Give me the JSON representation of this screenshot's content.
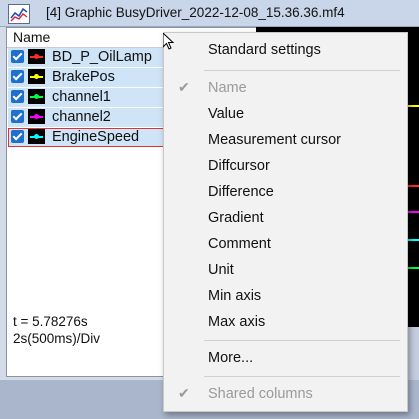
{
  "window": {
    "title": "[4] Graphic BusyDriver_2022-12-08_15.36.36.mf4"
  },
  "signal_list": {
    "column_header": "Name",
    "rows": [
      {
        "label": "BD_P_OilLamp",
        "color": "#ff2a2a",
        "checked": true,
        "selected": false
      },
      {
        "label": "BrakePos",
        "color": "#ffff00",
        "checked": true,
        "selected": false
      },
      {
        "label": "channel1",
        "color": "#00ff40",
        "checked": true,
        "selected": false
      },
      {
        "label": "channel2",
        "color": "#ff00ff",
        "checked": true,
        "selected": false
      },
      {
        "label": "EngineSpeed",
        "color": "#00ffff",
        "checked": true,
        "selected": true
      }
    ],
    "cursor_time": "t = 5.78276s",
    "time_div": "2s(500ms)/Div"
  },
  "context_menu": {
    "items": [
      {
        "label": "Standard settings",
        "enabled": true,
        "checked": false
      },
      {
        "label": "Name",
        "enabled": false,
        "checked": true
      },
      {
        "label": "Value",
        "enabled": true,
        "checked": false
      },
      {
        "label": "Measurement cursor",
        "enabled": true,
        "checked": false
      },
      {
        "label": "Diffcursor",
        "enabled": true,
        "checked": false
      },
      {
        "label": "Difference",
        "enabled": true,
        "checked": false
      },
      {
        "label": "Gradient",
        "enabled": true,
        "checked": false
      },
      {
        "label": "Comment",
        "enabled": true,
        "checked": false
      },
      {
        "label": "Unit",
        "enabled": true,
        "checked": false
      },
      {
        "label": "Min axis",
        "enabled": true,
        "checked": false
      },
      {
        "label": "Max axis",
        "enabled": true,
        "checked": false
      },
      {
        "label": "More...",
        "enabled": true,
        "checked": false
      },
      {
        "label": "Shared columns",
        "enabled": false,
        "checked": true
      }
    ]
  }
}
